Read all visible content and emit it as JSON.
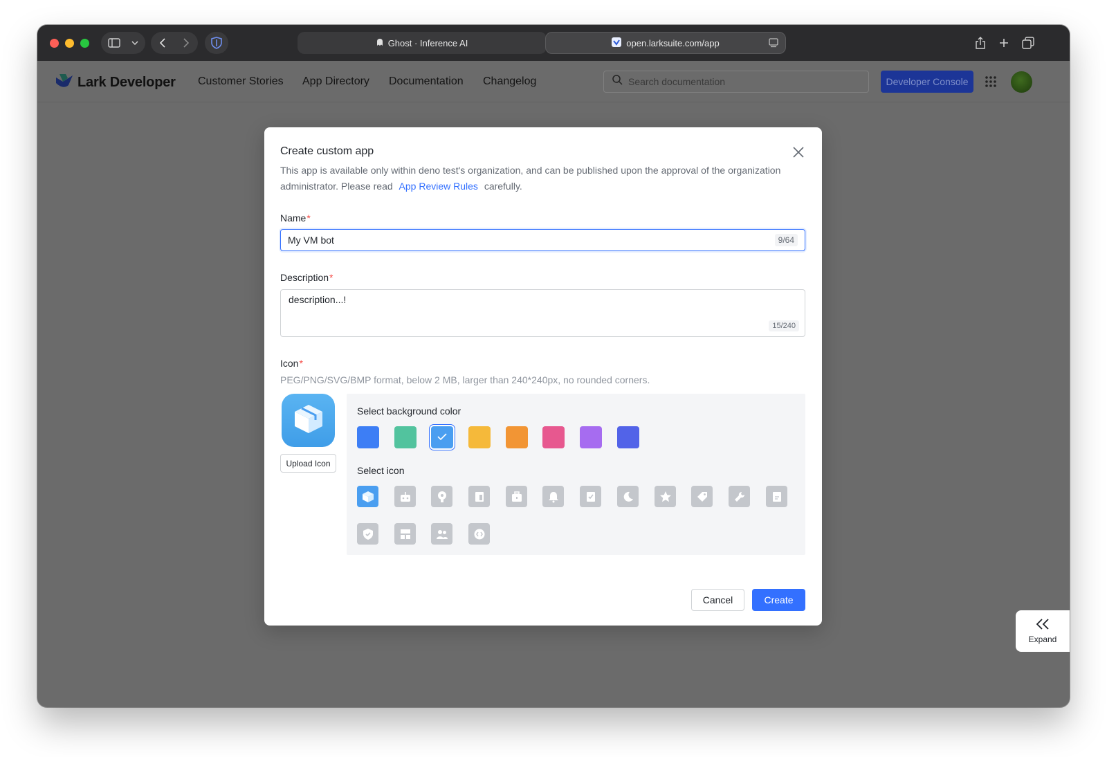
{
  "browser": {
    "tab_title": "Ghost · Inference AI",
    "url": "open.larksuite.com/app"
  },
  "nav": {
    "logo_text": "Lark Developer",
    "links": [
      "Customer Stories",
      "App Directory",
      "Documentation",
      "Changelog"
    ],
    "search_placeholder": "Search documentation",
    "console_button": "Developer Console"
  },
  "modal": {
    "title": "Create custom app",
    "description_prefix": "This app is available only within deno test's organization, and can be published upon the approval of the organization administrator. Please read",
    "description_link": "App Review Rules",
    "description_suffix": "carefully.",
    "name_label": "Name",
    "name_value": "My VM bot",
    "name_counter": "9/64",
    "description_label": "Description",
    "description_value": "description...!",
    "description_counter": "15/240",
    "icon_label": "Icon",
    "icon_hint": "PEG/PNG/SVG/BMP format, below 2 MB, larger than 240*240px, no rounded corners.",
    "upload_button": "Upload Icon",
    "bg_color_label": "Select background color",
    "bg_colors": [
      "#3d7ef5",
      "#52c39e",
      "#4a9ef0",
      "#f5b93a",
      "#f29534",
      "#e7588f",
      "#a66cf0",
      "#5263e8"
    ],
    "selected_bg_color_index": 2,
    "select_icon_label": "Select icon",
    "icons": [
      "cube-icon",
      "robot-icon",
      "lightbulb-icon",
      "document-icon",
      "briefcase-icon",
      "bell-icon",
      "checklist-icon",
      "moon-icon",
      "star-icon",
      "tag-icon",
      "wrench-icon",
      "file-icon",
      "shield-icon",
      "layout-icon",
      "users-icon",
      "code-icon"
    ],
    "selected_icon_index": 0,
    "cancel_button": "Cancel",
    "create_button": "Create"
  },
  "expand_label": "Expand"
}
